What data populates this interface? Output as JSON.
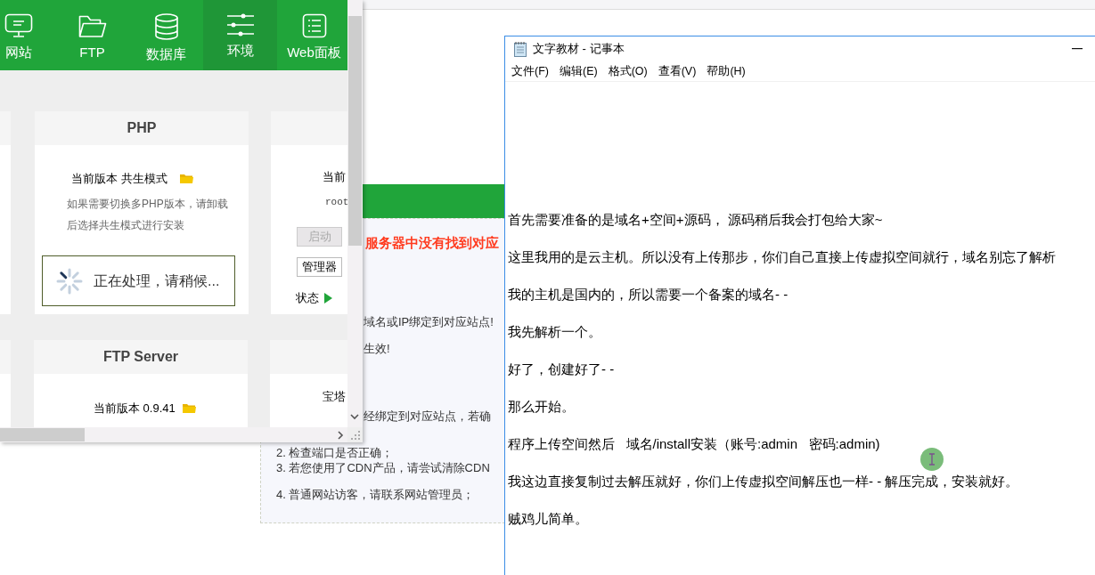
{
  "browser_page": {
    "banner_text": "服务器中没有找到对应",
    "notes": [
      {
        "kind": "partial",
        "text": "域名或IP绑定到对应站点!"
      },
      {
        "kind": "partial",
        "text": "生效!"
      },
      {
        "kind": "partial",
        "text": "经绑定到对应站点，若确"
      },
      {
        "kind": "numbered",
        "text": "2. 检查端口是否正确；"
      },
      {
        "kind": "numbered",
        "text": "3. 若您使用了CDN产品，请尝试清除CDN"
      },
      {
        "kind": "numbered",
        "text": "4. 普通网站访客，请联系网站管理员；"
      }
    ]
  },
  "panel_window": {
    "tabs": [
      {
        "label": "网站",
        "selected": false
      },
      {
        "label": "FTP",
        "selected": false
      },
      {
        "label": "数据库",
        "selected": false
      },
      {
        "label": "环境",
        "selected": true
      },
      {
        "label": "Web面板",
        "selected": false
      }
    ],
    "php_card": {
      "title": "PHP",
      "version": "当前版本 共生模式",
      "note": [
        "如果需要切换多PHP版本，请卸载",
        "后选择共生模式进行安装"
      ]
    },
    "side_card": {
      "version": "当前",
      "path": "root",
      "buttons": [
        {
          "label": "启动",
          "disabled": true
        },
        {
          "label": "管理器",
          "disabled": false
        }
      ],
      "status": "状态",
      "running": true
    },
    "ftp_card": {
      "title": "FTP Server",
      "version": "当前版本 0.9.41"
    },
    "side_card_2": {
      "text": "宝塔"
    },
    "loading_toast": "正在处理，请稍候..."
  },
  "notepad": {
    "title": "文字教材 - 记事本",
    "menu": [
      "文件(F)",
      "编辑(E)",
      "格式(O)",
      "查看(V)",
      "帮助(H)"
    ],
    "paragraph_groups": [
      [
        "首先需要准备的是域名+空间+源码， 源码稍后我会打包给大家~",
        "这里我用的是云主机。所以没有上传那步，你们自己直接上传虚拟空间就行，域名别忘了解析",
        "我的主机是国内的，所以需要一个备案的域名- -",
        "我先解析一个。",
        "好了，创建好了- -"
      ],
      [
        "那么开始。",
        "程序上传空间然后   域名/install安装（账号:admin   密码:admin)",
        "我这边直接复制过去解压就好，你们上传虚拟空间解压也一样- - 解压完成，安装就好。",
        "贼鸡儿简单。"
      ]
    ]
  }
}
